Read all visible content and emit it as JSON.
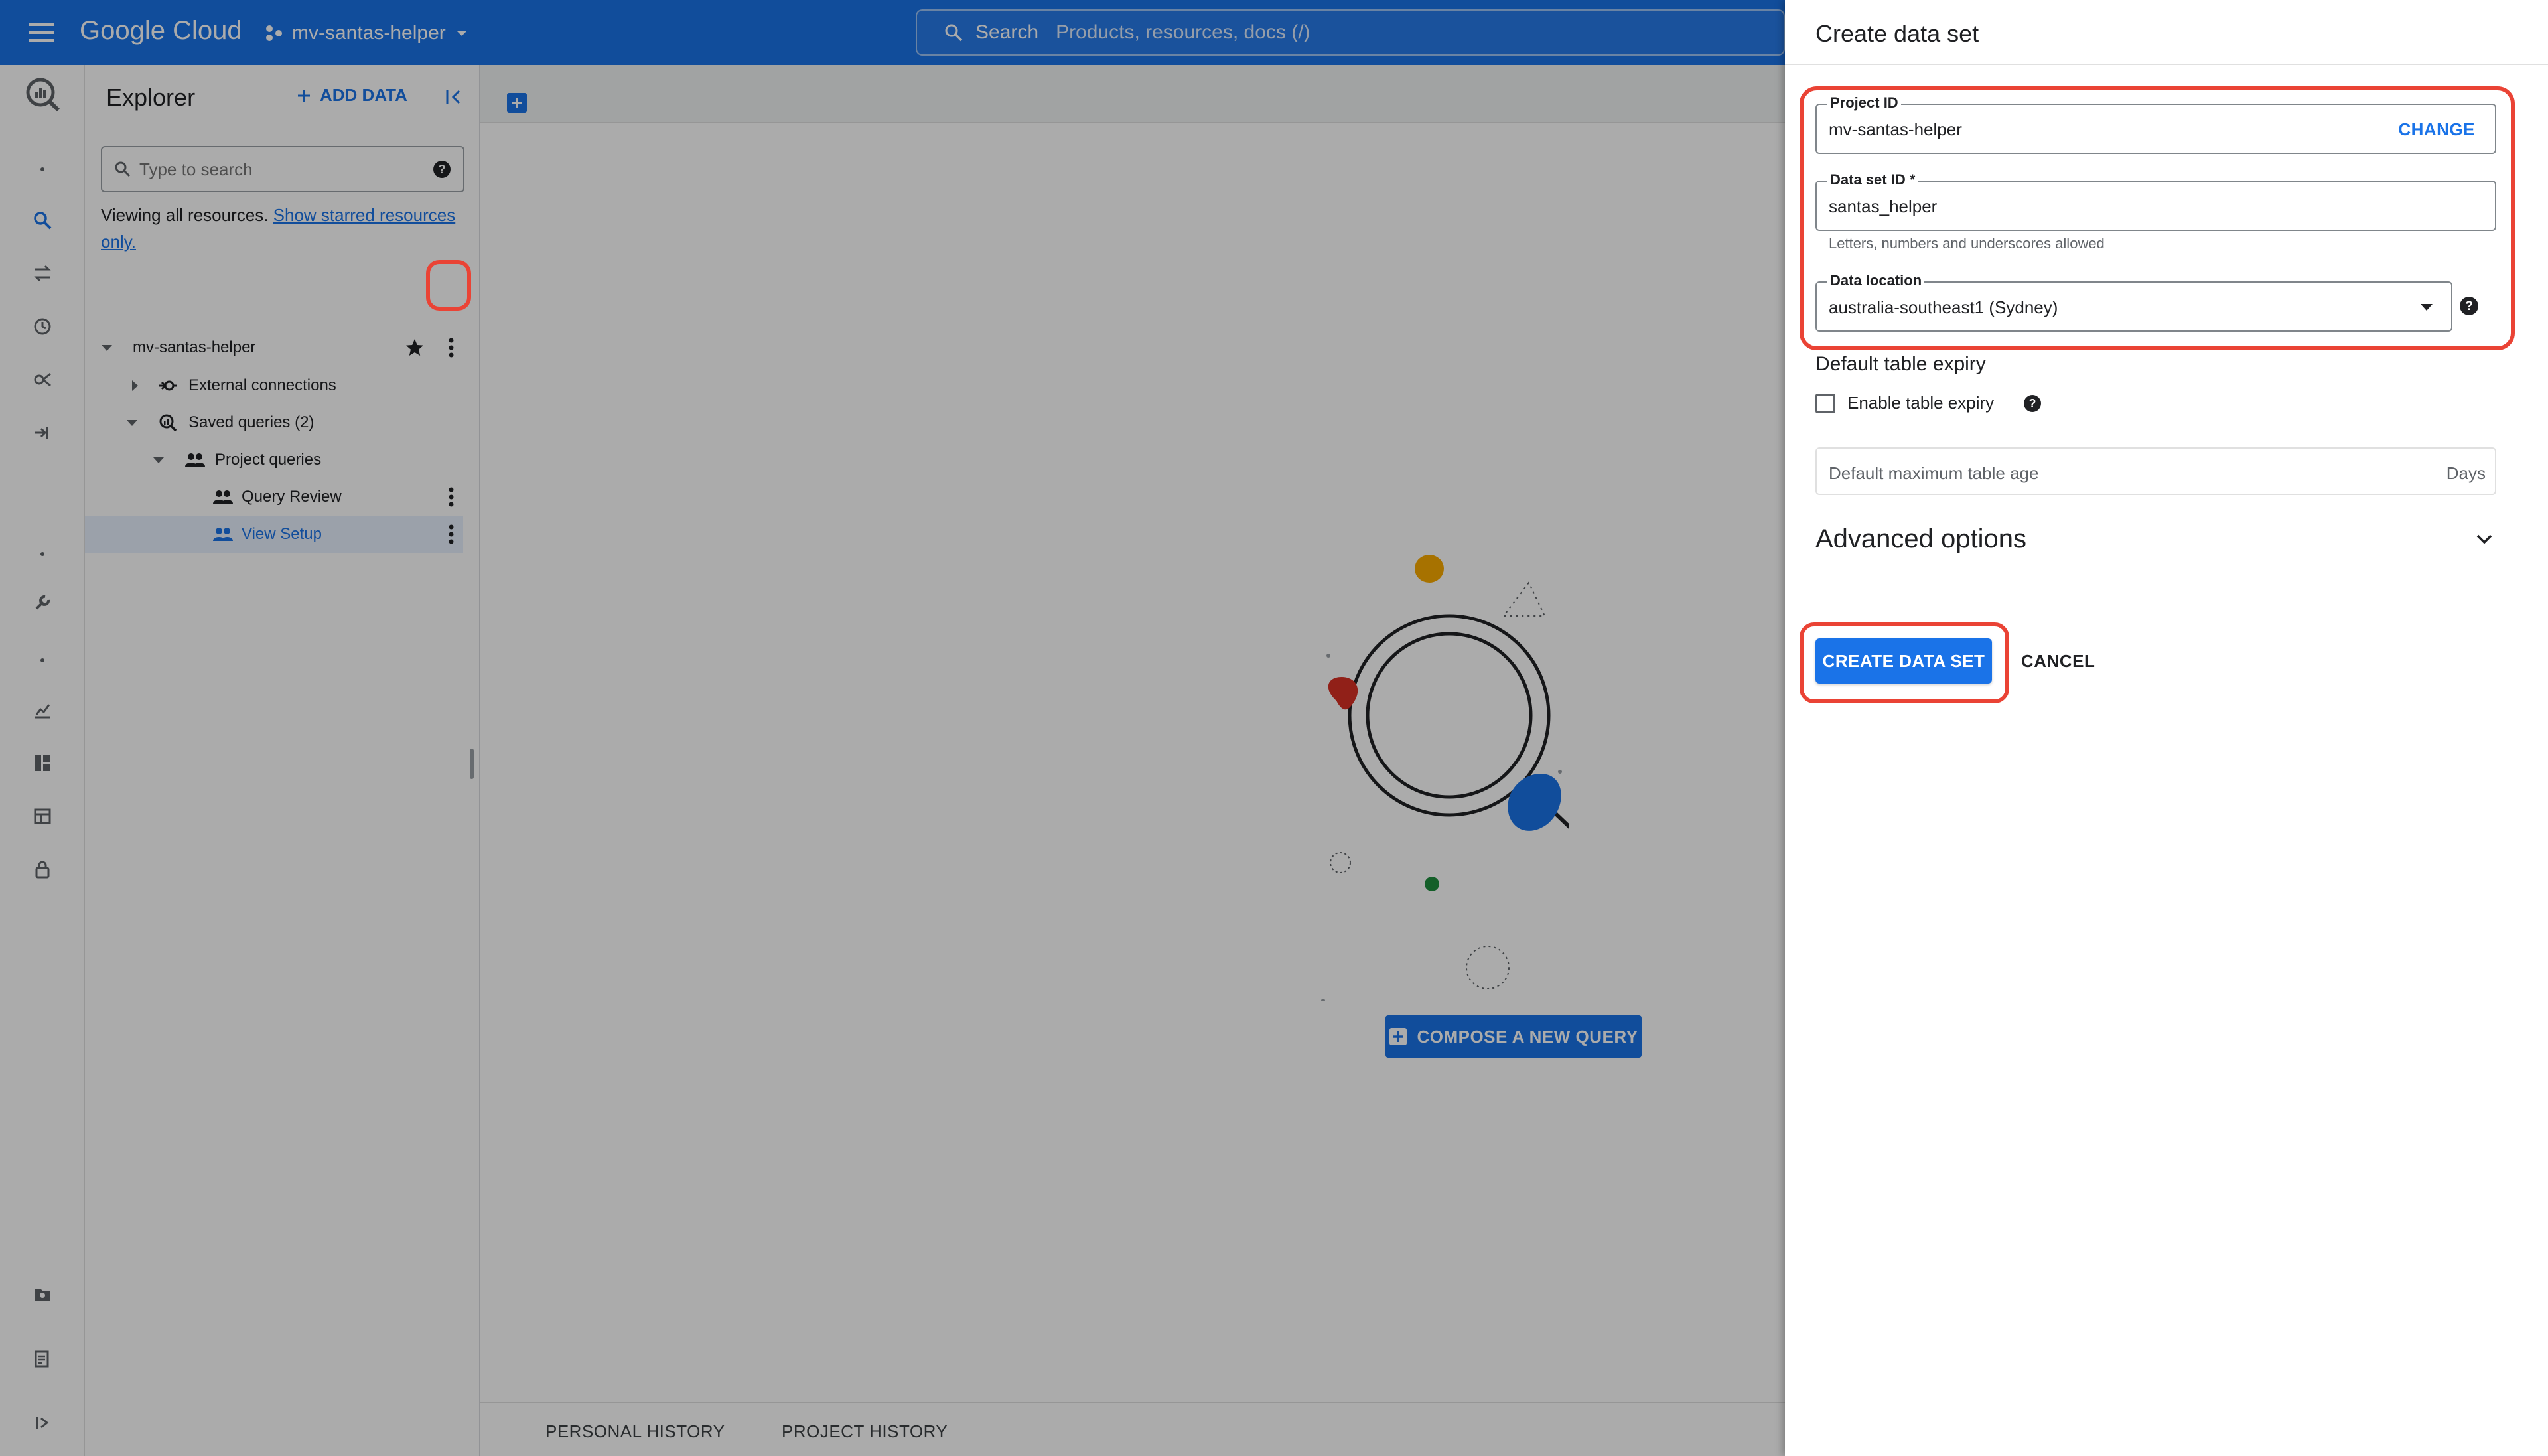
{
  "topbar": {
    "logo_text": "Google Cloud",
    "project_name": "mv-santas-helper",
    "search_label": "Search",
    "search_placeholder": "Products, resources, docs (/)"
  },
  "explorer": {
    "title": "Explorer",
    "add_data_label": "ADD DATA",
    "search_placeholder": "Type to search",
    "viewing_text": "Viewing all resources.",
    "starred_link_text": "Show starred resources only.",
    "tree": [
      {
        "label": "mv-santas-helper",
        "level": 0,
        "expanded": true,
        "starred": true
      },
      {
        "label": "External connections",
        "level": 1,
        "expanded": false
      },
      {
        "label": "Saved queries (2)",
        "level": 1,
        "expanded": true
      },
      {
        "label": "Project queries",
        "level": 2,
        "expanded": true
      },
      {
        "label": "Query Review",
        "level": 3
      },
      {
        "label": "View Setup",
        "level": 3,
        "selected": true
      }
    ]
  },
  "main": {
    "compose_button": "COMPOSE A NEW QUERY",
    "bottom_tabs": [
      "PERSONAL HISTORY",
      "PROJECT HISTORY"
    ]
  },
  "panel": {
    "title": "Create data set",
    "project_id": {
      "label": "Project ID",
      "value": "mv-santas-helper",
      "action": "CHANGE"
    },
    "dataset_id": {
      "label": "Data set ID *",
      "value": "santas_helper",
      "hint": "Letters, numbers and underscores allowed"
    },
    "location": {
      "label": "Data location",
      "value": "australia-southeast1 (Sydney)"
    },
    "default_expiry": {
      "section_title": "Default table expiry",
      "checkbox_label": "Enable table expiry",
      "checked": false,
      "max_age_placeholder": "Default maximum table age",
      "unit": "Days"
    },
    "advanced_label": "Advanced options",
    "create_button": "CREATE DATA SET",
    "cancel_button": "CANCEL"
  },
  "colors": {
    "brand_blue": "#1a73e8",
    "highlight_red": "#ea4335"
  },
  "icons": [
    "menu-icon",
    "project-icon",
    "search-icon",
    "help-icon",
    "star-icon",
    "kebab-icon",
    "collapse-panel-icon",
    "chevron-down-icon",
    "plus-icon"
  ]
}
